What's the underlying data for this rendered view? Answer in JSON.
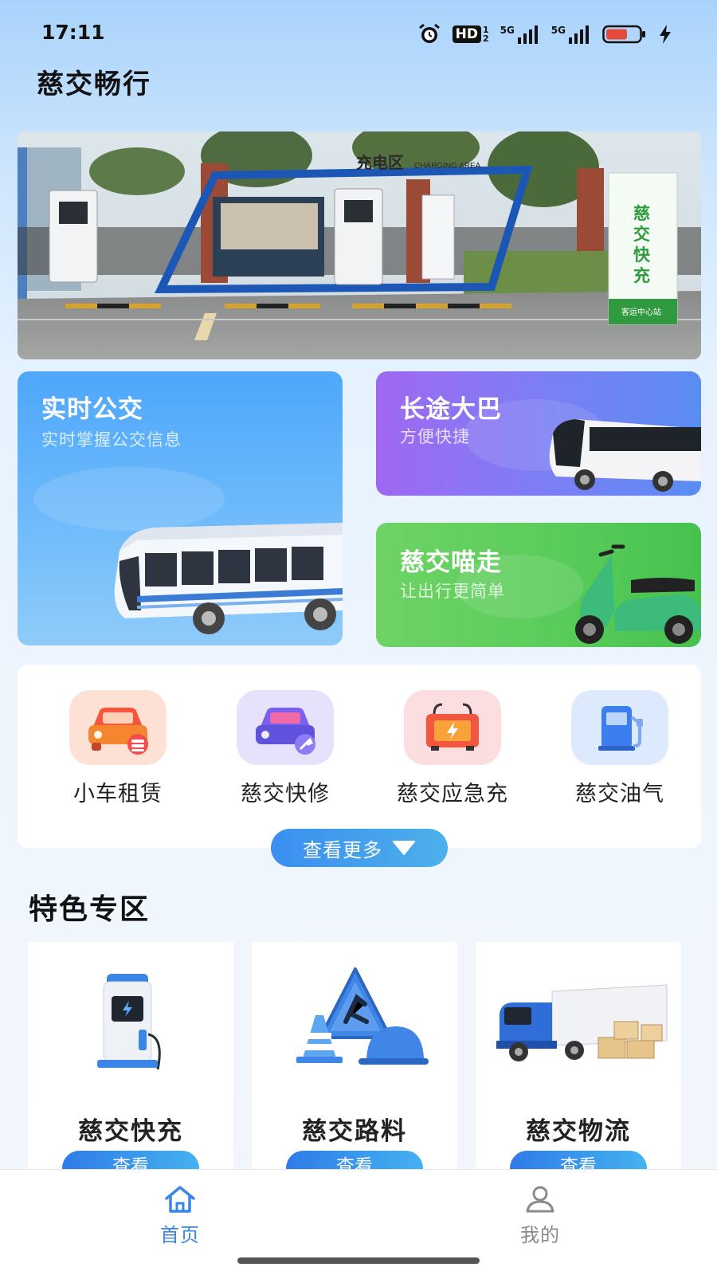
{
  "status": {
    "time": "17:11",
    "hd": "HD",
    "net1": "5G",
    "net2": "5G"
  },
  "app": {
    "title": "慈交畅行"
  },
  "banner": {
    "sign_top": "充电区",
    "sign_top_en": "CHARGING AREA",
    "pole_text": "慈交快充",
    "pole_sub": "客运中心站"
  },
  "cards": [
    {
      "title": "实时公交",
      "subtitle": "实时掌握公交信息"
    },
    {
      "title": "长途大巴",
      "subtitle": "方便快捷"
    },
    {
      "title": "慈交喵走",
      "subtitle": "让出行更简单"
    }
  ],
  "services": [
    {
      "label": "小车租赁",
      "icon": "car-rental-icon"
    },
    {
      "label": "慈交快修",
      "icon": "car-repair-icon"
    },
    {
      "label": "慈交应急充",
      "icon": "emergency-charge-icon"
    },
    {
      "label": "慈交油气",
      "icon": "fuel-pump-icon"
    }
  ],
  "more_label": "查看更多",
  "section_title": "特色专区",
  "features": [
    {
      "name": "慈交快充",
      "button": "查看",
      "icon": "charger-icon"
    },
    {
      "name": "慈交路料",
      "button": "查看",
      "icon": "road-work-icon"
    },
    {
      "name": "慈交物流",
      "button": "查看",
      "icon": "truck-icon"
    }
  ],
  "tabs": [
    {
      "label": "首页",
      "icon": "home-icon",
      "active": true
    },
    {
      "label": "我的",
      "icon": "user-icon",
      "active": false
    }
  ],
  "colors": {
    "accent": "#2f7be8",
    "tab_active": "#3a86e8",
    "tab_inactive": "#8a8a8a"
  }
}
